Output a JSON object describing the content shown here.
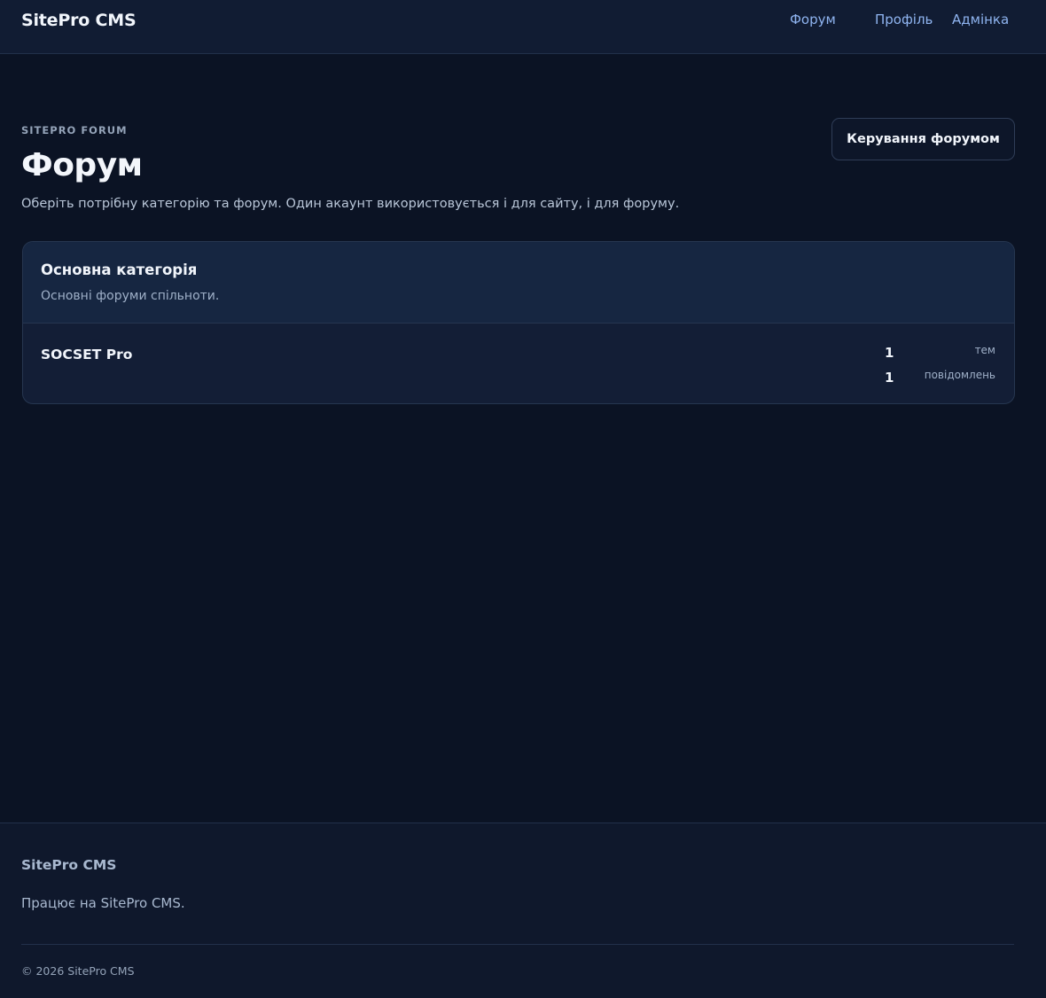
{
  "header": {
    "brand": "SitePro CMS",
    "nav": {
      "forum": "Форум",
      "profile": "Профіль",
      "admin": "Адмінка"
    }
  },
  "hero": {
    "eyebrow": "SITEPRO FORUM",
    "title": "Форум",
    "description": "Оберіть потрібну категорію та форум. Один акаунт використовується і для сайту, і для форуму.",
    "manage_button": "Керування форумом"
  },
  "category": {
    "title": "Основна категорія",
    "description": "Основні форуми спільноти.",
    "forums": [
      {
        "name": "SOCSET Pro",
        "topics_count": "1",
        "topics_label": "тем",
        "posts_count": "1",
        "posts_label": "повідомлень"
      }
    ]
  },
  "footer": {
    "brand": "SitePro CMS",
    "text": "Працює на SitePro CMS.",
    "copyright": "© 2026 SitePro CMS"
  },
  "colors": {
    "background": "#0b1324",
    "header": "#111c33",
    "link": "#8fb4f0",
    "card": "#131e36"
  }
}
